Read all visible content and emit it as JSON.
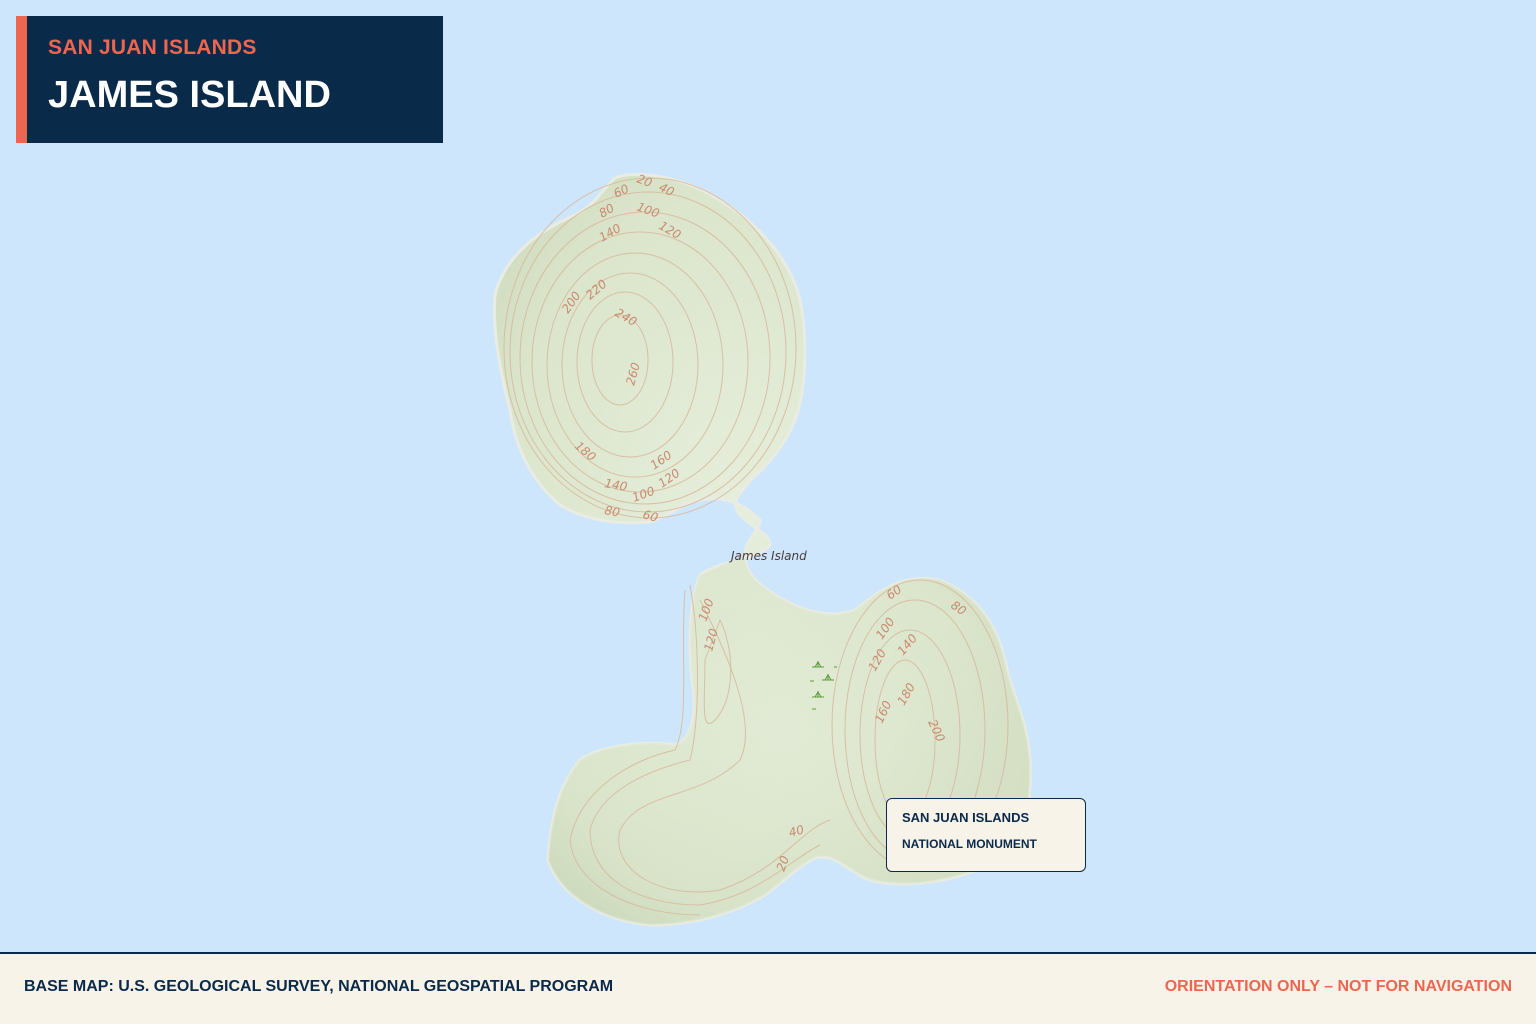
{
  "header": {
    "subtitle": "SAN JUAN ISLANDS",
    "title": "JAMES ISLAND"
  },
  "map": {
    "island_label": "James Island",
    "contour_labels_north": [
      "20",
      "40",
      "60",
      "80",
      "100",
      "120",
      "140",
      "200",
      "220",
      "240",
      "260",
      "180",
      "160",
      "140",
      "120",
      "100",
      "80",
      "60"
    ],
    "contour_labels_south": [
      "100",
      "120",
      "60",
      "80",
      "100",
      "120",
      "140",
      "160",
      "180",
      "200",
      "40",
      "20"
    ],
    "colors": {
      "water": "#cde6fc",
      "land": "#dfead2",
      "contour": "#d8b79a",
      "contour_label": "#c98a70",
      "accent": "#ee6650",
      "navy": "#0a2a4a"
    },
    "icons": [
      "marsh-icon"
    ]
  },
  "callout": {
    "line1": "SAN JUAN ISLANDS",
    "line2": "NATIONAL MONUMENT"
  },
  "footer": {
    "credit": "BASE MAP: U.S. GEOLOGICAL SURVEY, NATIONAL GEOSPATIAL PROGRAM",
    "disclaimer": "ORIENTATION ONLY – NOT FOR NAVIGATION"
  }
}
